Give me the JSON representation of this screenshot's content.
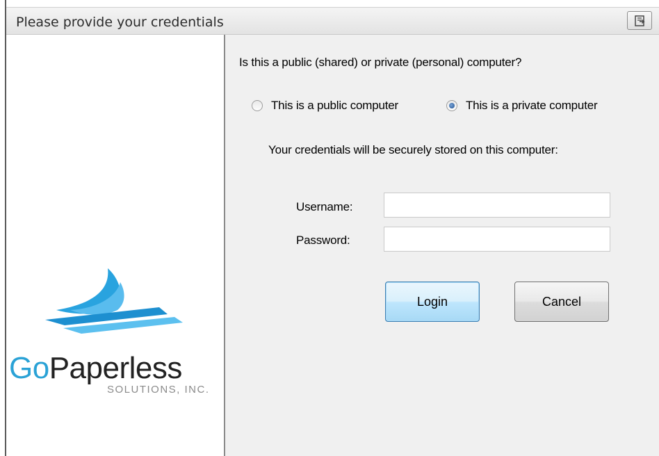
{
  "window": {
    "title": "Please provide your credentials",
    "title_button_icon": "restore-window-icon"
  },
  "logo": {
    "brand_primary": "Go",
    "brand_secondary": "Paperless",
    "brand_subtitle": "SOLUTIONS, INC.",
    "accent_color": "#2aa2d6",
    "icon": "paper-stack-logo-icon"
  },
  "form": {
    "question": "Is this a public (shared) or private (personal) computer?",
    "radio_public_label": "This is a public computer",
    "radio_private_label": "This is a private computer",
    "selected_option": "private",
    "stored_note": "Your credentials will be securely stored on this computer:",
    "username_label": "Username:",
    "username_value": "",
    "password_label": "Password:",
    "password_value": "",
    "login_label": "Login",
    "cancel_label": "Cancel"
  }
}
